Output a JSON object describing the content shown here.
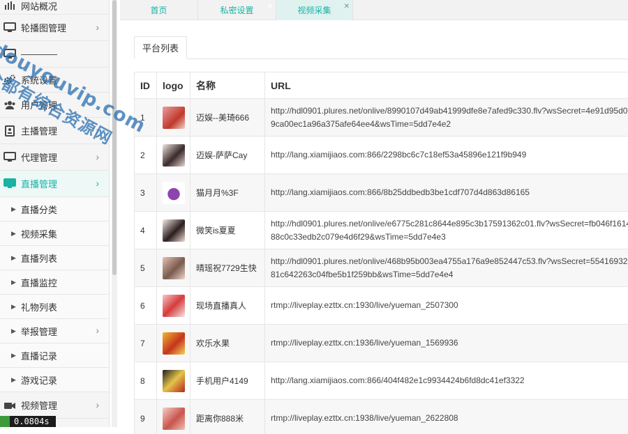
{
  "sidebar": {
    "items": [
      {
        "label": "网站概况",
        "icon": "bar-chart-icon",
        "arrow": ""
      },
      {
        "label": "轮播图管理",
        "icon": "monitor-icon",
        "arrow": "›"
      },
      {
        "label": "————",
        "icon": "monitor-icon",
        "arrow": ""
      },
      {
        "label": "系统设置",
        "icon": "gears-icon",
        "arrow": ""
      },
      {
        "label": "用户管理",
        "icon": "users-icon",
        "arrow": ""
      },
      {
        "label": "主播管理",
        "icon": "id-card-icon",
        "arrow": "›"
      },
      {
        "label": "代理管理",
        "icon": "monitor-icon",
        "arrow": "›"
      },
      {
        "label": "直播管理",
        "icon": "monitor-icon",
        "arrow": "›"
      }
    ],
    "sub_items": [
      "直播分类",
      "视频采集",
      "直播列表",
      "直播监控",
      "礼物列表",
      "举报管理",
      "直播记录",
      "游戏记录"
    ],
    "report_arrow": "›",
    "last_item": {
      "label": "视频管理",
      "arrow": "›"
    },
    "badge": "0.0804s"
  },
  "tabs": [
    {
      "label": "首页",
      "close": ""
    },
    {
      "label": "私密设置",
      "close": "✕"
    },
    {
      "label": "视频采集",
      "close": "✕"
    }
  ],
  "subtab": "平台列表",
  "table": {
    "headers": [
      "ID",
      "logo",
      "名称",
      "URL"
    ],
    "rows": [
      {
        "id": "1",
        "name": "迈娱--美琦666",
        "url": "http://hdl0901.plures.net/onlive/8990107d49ab41999dfe8e7afed9c330.flv?wsSecret=4e91d95d09ca00ec1a96a375afe64ee4&wsTime=5dd7e4e2"
      },
      {
        "id": "2",
        "name": "迈娱-萨萨Cay",
        "url": "http://lang.xiamijiaos.com:866/2298bc6c7c18ef53a45896e121f9b949"
      },
      {
        "id": "3",
        "name": "猫月月%3F",
        "url": "http://lang.xiamijiaos.com:866/8b25ddbedb3be1cdf707d4d863d86165"
      },
      {
        "id": "4",
        "name": "微笑is夏夏",
        "url": "http://hdl0901.plures.net/onlive/e6775c281c8644e895c3b17591362c01.flv?wsSecret=fb046f161488c0c33edb2c079e4d6f29&wsTime=5dd7e4e3"
      },
      {
        "id": "5",
        "name": "晴瑶祝7729生快",
        "url": "http://hdl0901.plures.net/onlive/468b95b003ea4755a176a9e852447c53.flv?wsSecret=5541693281c642263c04fbe5b1f259bb&wsTime=5dd7e4e4"
      },
      {
        "id": "6",
        "name": "现场直播真人",
        "url": "rtmp://liveplay.ezttx.cn:1930/live/yueman_2507300"
      },
      {
        "id": "7",
        "name": "欢乐水果",
        "url": "rtmp://liveplay.ezttx.cn:1936/live/yueman_1569936"
      },
      {
        "id": "8",
        "name": "手机用户4149",
        "url": "http://lang.xiamijiaos.com:866/404f482e1c9934424b6fd8dc41ef3322"
      },
      {
        "id": "9",
        "name": "距离你888米",
        "url": "rtmp://liveplay.ezttx.cn:1938/live/yueman_2622808"
      }
    ]
  },
  "watermark": {
    "line1": "douyouvip.com",
    "line2": "全都有综合资源网"
  },
  "colors": {
    "accent": "#17b3a3",
    "watermark": "#286eaf"
  }
}
